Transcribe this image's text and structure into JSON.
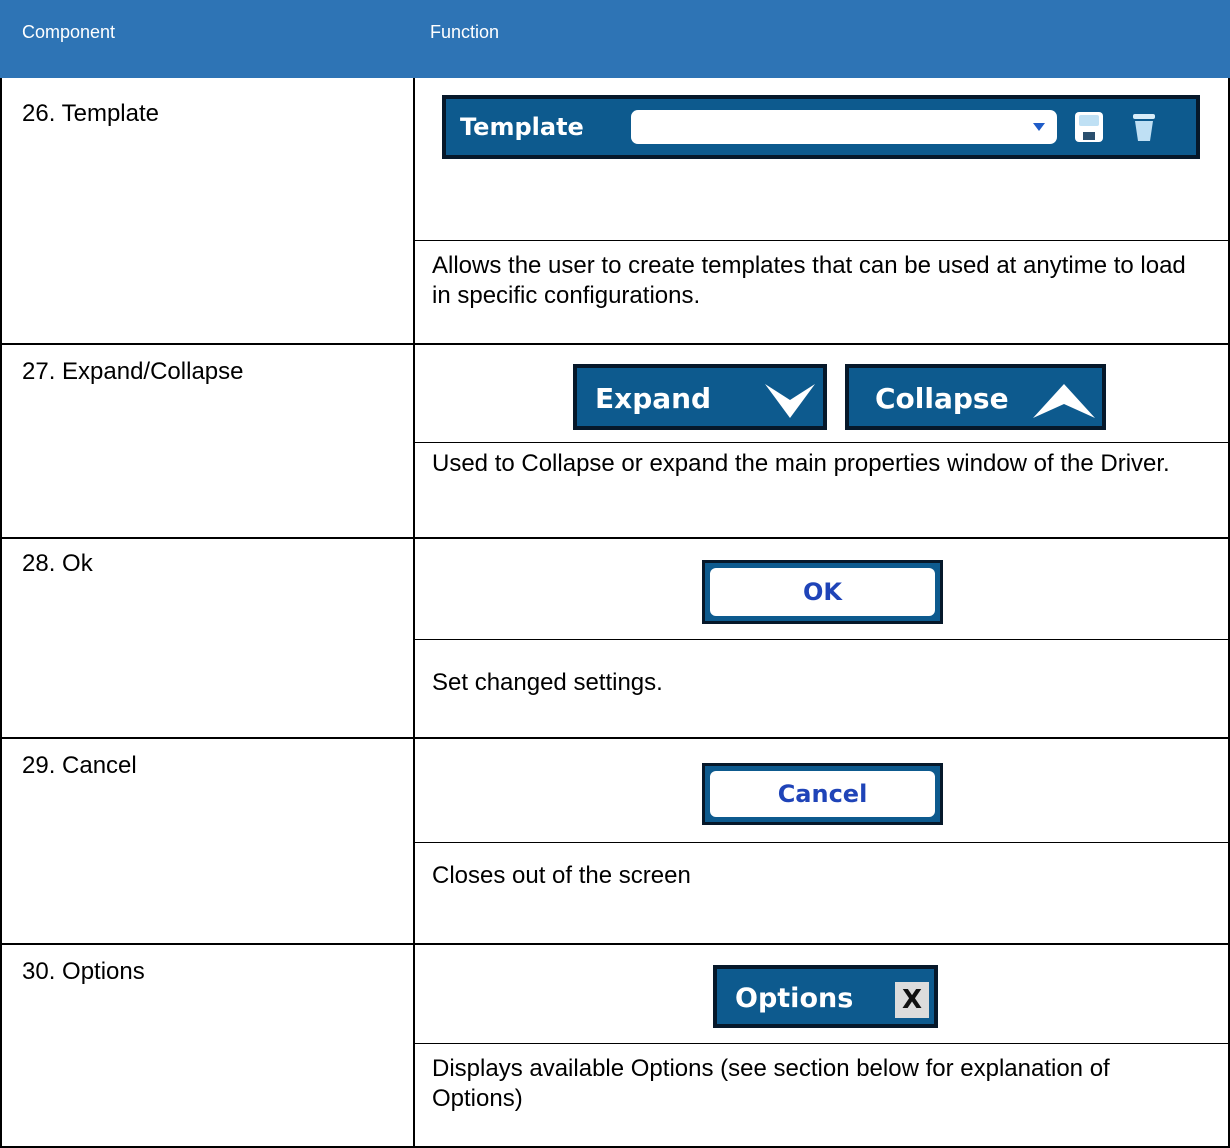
{
  "table": {
    "headers": {
      "component": "Component",
      "function": "Function"
    },
    "rows": [
      {
        "component": "26. Template",
        "widget": {
          "label": "Template",
          "dropdown_value": "",
          "icons": [
            "save-icon",
            "trash-icon"
          ]
        },
        "description": "Allows the user to create templates that can be used at anytime to load in specific configurations."
      },
      {
        "component": "27. Expand/Collapse",
        "widget": {
          "expand_label": "Expand",
          "collapse_label": "Collapse",
          "icons": [
            "chevron-down-icon",
            "chevron-up-icon"
          ]
        },
        "description": "Used to Collapse or expand the main properties window of the Driver."
      },
      {
        "component": "28. Ok",
        "widget": {
          "label": "OK"
        },
        "description": "Set changed settings."
      },
      {
        "component": "29. Cancel",
        "widget": {
          "label": "Cancel"
        },
        "description": "Closes out of the screen"
      },
      {
        "component": "30. Options",
        "widget": {
          "label": "Options",
          "close_glyph": "X"
        },
        "description": "Displays available Options (see section below for explanation of Options)"
      }
    ]
  },
  "colors": {
    "header_bg": "#2e74b5",
    "button_bg": "#0d5a8e",
    "button_border": "#06182a",
    "button_text_blue": "#1f44b8"
  }
}
